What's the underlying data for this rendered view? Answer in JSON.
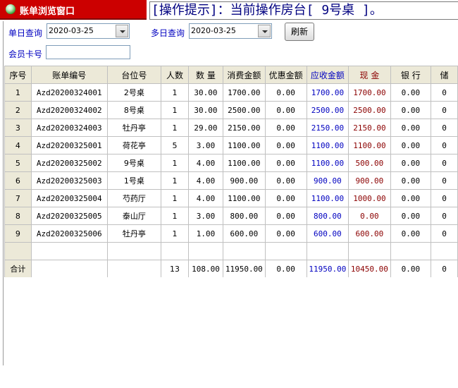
{
  "window": {
    "title": "账单浏览窗口",
    "hint": "[操作提示]：当前操作房台[ 9号桌 ]。"
  },
  "filters": {
    "single_day_label": "单日查询",
    "single_day_value": "2020-03-25",
    "multi_day_label": "多日查询",
    "multi_day_value": "2020-03-25",
    "refresh_label": "刷新",
    "member_card_label": "会员卡号",
    "member_card_value": ""
  },
  "table": {
    "columns": [
      "序号",
      "账单编号",
      "台位号",
      "人数",
      "数 量",
      "消费金额",
      "优惠金额",
      "应收金额",
      "现 金",
      "银 行",
      "储"
    ],
    "rows": [
      [
        "1",
        "Azd20200324001",
        "2号桌",
        "1",
        "30.00",
        "1700.00",
        "0.00",
        "1700.00",
        "1700.00",
        "0.00",
        "0"
      ],
      [
        "2",
        "Azd20200324002",
        "8号桌",
        "1",
        "30.00",
        "2500.00",
        "0.00",
        "2500.00",
        "2500.00",
        "0.00",
        "0"
      ],
      [
        "3",
        "Azd20200324003",
        "牡丹亭",
        "1",
        "29.00",
        "2150.00",
        "0.00",
        "2150.00",
        "2150.00",
        "0.00",
        "0"
      ],
      [
        "4",
        "Azd20200325001",
        "荷花亭",
        "5",
        "3.00",
        "1100.00",
        "0.00",
        "1100.00",
        "1100.00",
        "0.00",
        "0"
      ],
      [
        "5",
        "Azd20200325002",
        "9号桌",
        "1",
        "4.00",
        "1100.00",
        "0.00",
        "1100.00",
        "500.00",
        "0.00",
        "0"
      ],
      [
        "6",
        "Azd20200325003",
        "1号桌",
        "1",
        "4.00",
        "900.00",
        "0.00",
        "900.00",
        "900.00",
        "0.00",
        "0"
      ],
      [
        "7",
        "Azd20200325004",
        "芍药厅",
        "1",
        "4.00",
        "1100.00",
        "0.00",
        "1100.00",
        "1000.00",
        "0.00",
        "0"
      ],
      [
        "8",
        "Azd20200325005",
        "泰山厅",
        "1",
        "3.00",
        "800.00",
        "0.00",
        "800.00",
        "0.00",
        "0.00",
        "0"
      ],
      [
        "9",
        "Azd20200325006",
        "牡丹亭",
        "1",
        "1.00",
        "600.00",
        "0.00",
        "600.00",
        "600.00",
        "0.00",
        "0"
      ]
    ],
    "empty_row": [
      "",
      "",
      "",
      "",
      "",
      "",
      "",
      "",
      "",
      "",
      ""
    ],
    "total_row": [
      "合计",
      "",
      "",
      "13",
      "108.00",
      "11950.00",
      "0.00",
      "11950.00",
      "10450.00",
      "0.00",
      "0"
    ]
  }
}
